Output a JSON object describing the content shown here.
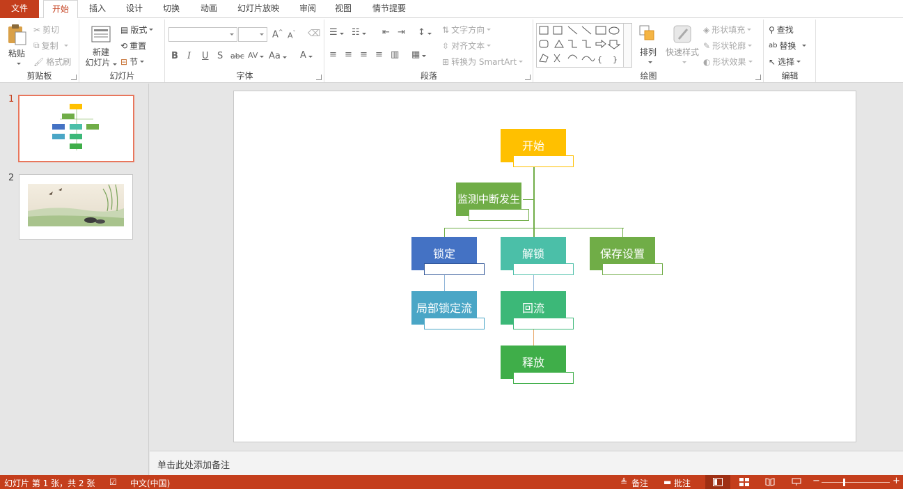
{
  "tabs": [
    "文件",
    "开始",
    "插入",
    "设计",
    "切换",
    "动画",
    "幻灯片放映",
    "审阅",
    "视图",
    "情节提要"
  ],
  "active_tab": "开始",
  "ribbon": {
    "clipboard": {
      "label": "剪贴板",
      "paste": "粘贴",
      "cut": "剪切",
      "copy": "复制",
      "format_painter": "格式刷"
    },
    "slides": {
      "label": "幻灯片",
      "new_slide_line1": "新建",
      "new_slide_line2": "幻灯片",
      "layout": "版式",
      "reset": "重置",
      "section": "节"
    },
    "font": {
      "label": "字体",
      "bold": "B",
      "italic": "I",
      "underline": "U",
      "shadow": "S",
      "strike": "abc",
      "spacing": "AV",
      "case": "Aa",
      "color": "A",
      "grow": "A",
      "shrink": "A"
    },
    "paragraph": {
      "label": "段落",
      "text_direction": "文字方向",
      "align_text": "对齐文本",
      "smartart": "转换为 SmartArt"
    },
    "drawing": {
      "label": "绘图",
      "arrange": "排列",
      "quick_styles": "快速样式",
      "shape_fill": "形状填充",
      "shape_outline": "形状轮廓",
      "shape_effects": "形状效果"
    },
    "editing": {
      "label": "编辑",
      "find": "查找",
      "replace": "替换",
      "select": "选择"
    }
  },
  "thumbnails": [
    {
      "number": "1",
      "active": true
    },
    {
      "number": "2",
      "active": false
    }
  ],
  "chart": {
    "nodes": [
      {
        "id": "start",
        "label": "开始",
        "color": "#ffc000",
        "border": "#ffc000"
      },
      {
        "id": "monitor",
        "label": "监测中断发生",
        "color": "#70ad47",
        "border": "#70ad47"
      },
      {
        "id": "lock",
        "label": "锁定",
        "color": "#4472c4",
        "border": "#2f5597"
      },
      {
        "id": "unlock",
        "label": "解锁",
        "color": "#4bbfa8",
        "border": "#4bbfa8"
      },
      {
        "id": "save",
        "label": "保存设置",
        "color": "#70ad47",
        "border": "#70ad47"
      },
      {
        "id": "partial",
        "label": "局部锁定流",
        "color": "#4aa6c6",
        "border": "#4aa6c6"
      },
      {
        "id": "backflow",
        "label": "回流",
        "color": "#3cb878",
        "border": "#3cb878"
      },
      {
        "id": "release",
        "label": "释放",
        "color": "#3fae49",
        "border": "#3fae49"
      }
    ]
  },
  "notes_placeholder": "单击此处添加备注",
  "status": {
    "slide_info": "幻灯片 第 1 张，共 2 张",
    "language": "中文(中国)",
    "notes": "备注",
    "comments": "批注"
  },
  "accent_color": "#c43e1c"
}
